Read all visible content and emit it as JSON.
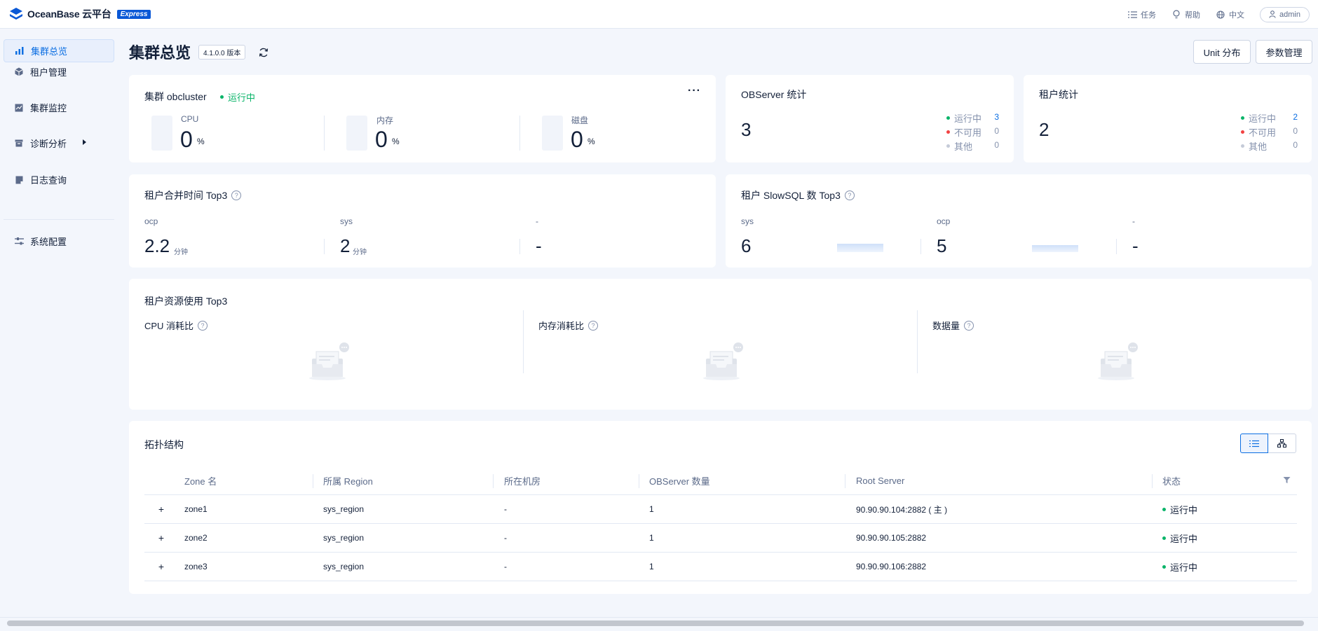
{
  "header": {
    "brand_name": "OceanBase 云平台",
    "brand_badge": "Express",
    "actions": [
      {
        "label": "任务",
        "icon": "list-icon"
      },
      {
        "label": "帮助",
        "icon": "bulb-icon"
      },
      {
        "label": "中文",
        "icon": "globe-icon"
      }
    ],
    "user": "admin"
  },
  "sidebar": {
    "items": [
      {
        "label": "集群总览",
        "icon": "bar-chart-icon",
        "active": true
      },
      {
        "label": "租户管理",
        "icon": "cube-icon"
      },
      {
        "label": "集群监控",
        "icon": "monitor-icon"
      },
      {
        "label": "诊断分析",
        "icon": "box-icon"
      },
      {
        "label": "日志查询",
        "icon": "document-icon"
      },
      {
        "label": "系统配置",
        "icon": "sliders-icon"
      }
    ]
  },
  "page": {
    "title": "集群总览",
    "version": "4.1.0.0 版本",
    "buttons": {
      "unit": "Unit 分布",
      "params": "参数管理"
    }
  },
  "cluster_card": {
    "title": "集群 obcluster",
    "status": "运行中",
    "more": "···",
    "metrics": [
      {
        "label": "CPU",
        "value": "0",
        "unit": "%"
      },
      {
        "label": "内存",
        "value": "0",
        "unit": "%"
      },
      {
        "label": "磁盘",
        "value": "0",
        "unit": "%"
      }
    ]
  },
  "observer_card": {
    "title": "OBServer 统计",
    "total": "3",
    "legend": [
      {
        "label": "运行中",
        "value": "3",
        "color": "#0ab469"
      },
      {
        "label": "不可用",
        "value": "0",
        "color": "#f24242"
      },
      {
        "label": "其他",
        "value": "0",
        "color": "#c5cbd8"
      }
    ]
  },
  "tenant_card": {
    "title": "租户统计",
    "total": "2",
    "legend": [
      {
        "label": "运行中",
        "value": "2",
        "color": "#0ab469"
      },
      {
        "label": "不可用",
        "value": "0",
        "color": "#f24242"
      },
      {
        "label": "其他",
        "value": "0",
        "color": "#c5cbd8"
      }
    ]
  },
  "merge_card": {
    "title": "租户合并时间 Top3",
    "items": [
      {
        "name": "ocp",
        "value": "2.2",
        "unit": "分钟"
      },
      {
        "name": "sys",
        "value": "2",
        "unit": "分钟"
      },
      {
        "name": "-",
        "value": "-",
        "unit": ""
      }
    ]
  },
  "slowsql_card": {
    "title": "租户 SlowSQL 数 Top3",
    "items": [
      {
        "name": "sys",
        "value": "6"
      },
      {
        "name": "ocp",
        "value": "5"
      },
      {
        "name": "-",
        "value": "-"
      }
    ]
  },
  "resource_card": {
    "title": "租户资源使用 Top3",
    "sections": [
      {
        "title": "CPU 消耗比"
      },
      {
        "title": "内存消耗比"
      },
      {
        "title": "数据量"
      }
    ]
  },
  "topology": {
    "title": "拓扑结构",
    "columns": [
      "Zone 名",
      "所属 Region",
      "所在机房",
      "OBServer 数量",
      "Root Server",
      "状态"
    ],
    "rows": [
      {
        "zone": "zone1",
        "region": "sys_region",
        "idc": "-",
        "count": "1",
        "root": "90.90.90.104:2882 ( 主 )",
        "status": "运行中"
      },
      {
        "zone": "zone2",
        "region": "sys_region",
        "idc": "-",
        "count": "1",
        "root": "90.90.90.105:2882",
        "status": "运行中"
      },
      {
        "zone": "zone3",
        "region": "sys_region",
        "idc": "-",
        "count": "1",
        "root": "90.90.90.106:2882",
        "status": "运行中"
      }
    ]
  },
  "colors": {
    "primary": "#0b6ee2",
    "success": "#0ab469",
    "error": "#f24242"
  }
}
